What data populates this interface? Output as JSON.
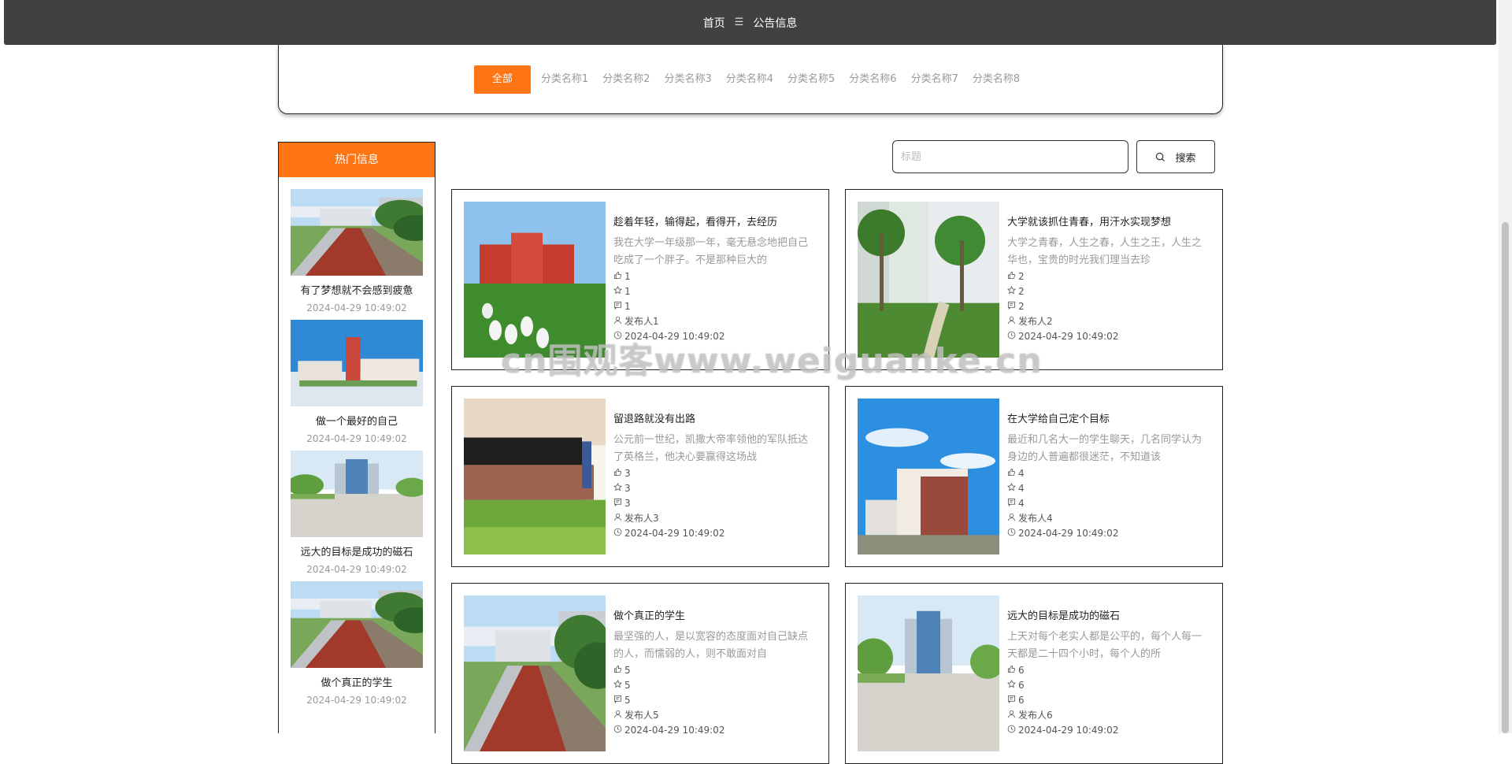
{
  "topbar": {
    "home": "首页",
    "separator": "☰",
    "current": "公告信息"
  },
  "categories": [
    "全部",
    "分类名称1",
    "分类名称2",
    "分类名称3",
    "分类名称4",
    "分类名称5",
    "分类名称6",
    "分类名称7",
    "分类名称8"
  ],
  "sidebar": {
    "title": "热门信息",
    "items": [
      {
        "title": "有了梦想就不会感到疲惫",
        "date": "2024-04-29 10:49:02",
        "scene": "track"
      },
      {
        "title": "做一个最好的自己",
        "date": "2024-04-29 10:49:02",
        "scene": "campus"
      },
      {
        "title": "远大的目标是成功的磁石",
        "date": "2024-04-29 10:49:02",
        "scene": "plaza"
      },
      {
        "title": "做个真正的学生",
        "date": "2024-04-29 10:49:02",
        "scene": "track"
      }
    ]
  },
  "search": {
    "placeholder": "标题",
    "button": "搜索"
  },
  "cards": [
    {
      "title": "趁着年轻，输得起，看得开，去经历",
      "desc": "我在大学一年级那一年，毫无悬念地把自己吃成了一个胖子。不是那种巨大的",
      "likes": "1",
      "stars": "1",
      "comments": "1",
      "author": "发布人1",
      "date": "2024-04-29 10:49:02",
      "scene": "geese"
    },
    {
      "title": "大学就该抓住青春，用汗水实现梦想",
      "desc": "大学之青春，人生之春，人生之王，人生之华也，宝贵的时光我们理当去珍",
      "likes": "2",
      "stars": "2",
      "comments": "2",
      "author": "发布人2",
      "date": "2024-04-29 10:49:02",
      "scene": "palms"
    },
    {
      "title": "留退路就没有出路",
      "desc": "公元前一世纪，凯撒大帝率领他的军队抵达了英格兰，他决心要赢得这场战",
      "likes": "3",
      "stars": "3",
      "comments": "3",
      "author": "发布人3",
      "date": "2024-04-29 10:49:02",
      "scene": "wall"
    },
    {
      "title": "在大学给自己定个目标",
      "desc": "最近和几名大一的学生聊天，几名同学认为身边的人普遍都很迷茫，不知道该",
      "likes": "4",
      "stars": "4",
      "comments": "4",
      "author": "发布人4",
      "date": "2024-04-29 10:49:02",
      "scene": "building"
    },
    {
      "title": "做个真正的学生",
      "desc": "最坚强的人，是以宽容的态度面对自己缺点的人，而懦弱的人，则不敢面对自",
      "likes": "5",
      "stars": "5",
      "comments": "5",
      "author": "发布人5",
      "date": "2024-04-29 10:49:02",
      "scene": "track"
    },
    {
      "title": "远大的目标是成功的磁石",
      "desc": "上天对每个老实人都是公平的，每个人每一天都是二十四个小时，每个人的所",
      "likes": "6",
      "stars": "6",
      "comments": "6",
      "author": "发布人6",
      "date": "2024-04-29 10:49:02",
      "scene": "plaza"
    }
  ],
  "watermark": "cn围观客www.weiguanke.cn"
}
